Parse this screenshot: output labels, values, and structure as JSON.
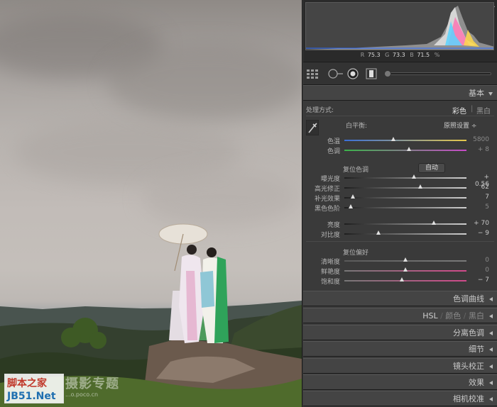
{
  "watermark": {
    "line1": "脚本之家",
    "line2": "JB51.Net",
    "studio": "摄影专题",
    "url": "...o.poco.cn"
  },
  "histogram": {
    "r_label": "R",
    "r_value": "75.3",
    "g_label": "G",
    "g_value": "73.3",
    "b_label": "B",
    "b_value": "71.5",
    "unit": "%"
  },
  "basic": {
    "title": "基本",
    "treatment_label": "处理方式:",
    "treatment_color": "彩色",
    "treatment_bw": "黑白",
    "wb_label": "白平衡:",
    "wb_value": "原照设置 ÷",
    "tone_label": "复位色调",
    "auto_label": "自动",
    "presence_label": "复位偏好",
    "sliders": [
      {
        "name": "temp",
        "label": "色温",
        "value": "5800",
        "pos": 0.4,
        "dim": true
      },
      {
        "name": "tint",
        "label": "色调",
        "value": "+ 8",
        "pos": 0.53,
        "dim": true
      },
      {
        "name": "exposure",
        "label": "曝光度",
        "value": "+ 0.56",
        "pos": 0.57,
        "dim": false
      },
      {
        "name": "recovery",
        "label": "高光修正",
        "value": "62",
        "pos": 0.62,
        "dim": false
      },
      {
        "name": "fill",
        "label": "补光效果",
        "value": "7",
        "pos": 0.07,
        "dim": false
      },
      {
        "name": "blacks",
        "label": "黑色色阶",
        "value": "5",
        "pos": 0.05,
        "dim": true
      },
      {
        "name": "brightness",
        "label": "亮度",
        "value": "+ 70",
        "pos": 0.73,
        "dim": false
      },
      {
        "name": "contrast",
        "label": "对比度",
        "value": "− 9",
        "pos": 0.28,
        "dim": false
      },
      {
        "name": "clarity",
        "label": "清晰度",
        "value": "0",
        "pos": 0.5,
        "dim": true
      },
      {
        "name": "vibrance",
        "label": "鲜艳度",
        "value": "0",
        "pos": 0.5,
        "dim": true
      },
      {
        "name": "saturation",
        "label": "饱和度",
        "value": "− 7",
        "pos": 0.47,
        "dim": false
      }
    ]
  },
  "sections": {
    "tone_curve": "色调曲线",
    "hsl": "HSL",
    "hsl_color": "颜色",
    "hsl_bw": "黑白",
    "split_toning": "分离色调",
    "detail": "细节",
    "lens": "镜头校正",
    "effects": "效果",
    "camera": "相机校准"
  },
  "icons": [
    "eyedropper-icon",
    "grid-icon",
    "crop-circle-icon",
    "redeye-icon",
    "gradient-icon"
  ]
}
